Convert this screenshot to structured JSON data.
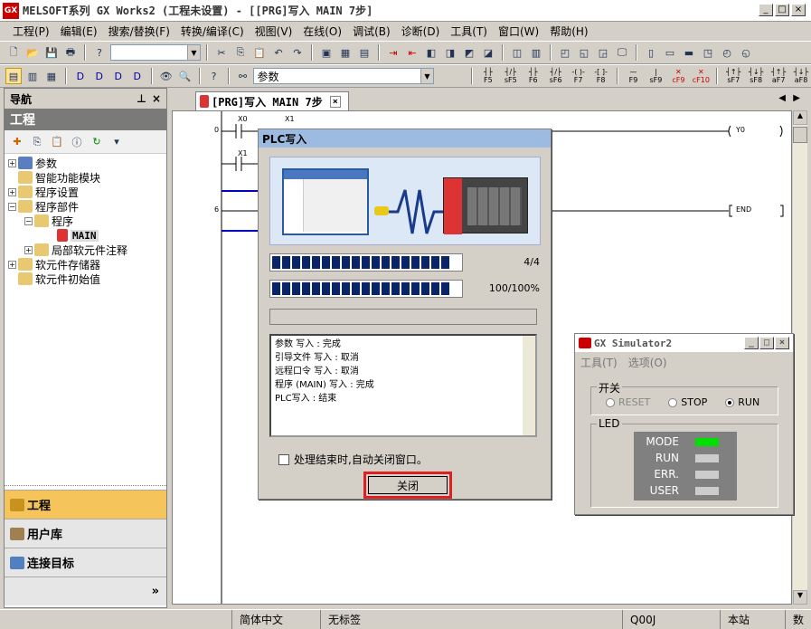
{
  "window": {
    "title": "MELSOFT系列 GX Works2 (工程未设置) - [[PRG]写入 MAIN 7步]",
    "icon_text": "GX"
  },
  "menu": [
    "工程(P)",
    "编辑(E)",
    "搜索/替换(F)",
    "转换/编译(C)",
    "视图(V)",
    "在线(O)",
    "调试(B)",
    "诊断(D)",
    "工具(T)",
    "窗口(W)",
    "帮助(H)"
  ],
  "toolbar2": {
    "combo_value": "参数"
  },
  "function_keys": [
    "F5",
    "sF5",
    "F6",
    "sF6",
    "F7",
    "F8",
    "F9",
    "sF9",
    "cF9",
    "cF10",
    "sF7",
    "sF8",
    "aF7",
    "aF8"
  ],
  "nav": {
    "header": "导航",
    "title": "工程",
    "tree": [
      {
        "label": "参数",
        "level": 0,
        "expander": "+"
      },
      {
        "label": "智能功能模块",
        "level": 0,
        "expander": ""
      },
      {
        "label": "程序设置",
        "level": 0,
        "expander": "+"
      },
      {
        "label": "程序部件",
        "level": 0,
        "expander": "−"
      },
      {
        "label": "程序",
        "level": 1,
        "expander": "−"
      },
      {
        "label": "MAIN",
        "level": 2,
        "expander": ""
      },
      {
        "label": "局部软元件注释",
        "level": 1,
        "expander": "+"
      },
      {
        "label": "软元件存储器",
        "level": 0,
        "expander": "+"
      },
      {
        "label": "软元件初始值",
        "level": 0,
        "expander": ""
      }
    ],
    "bottom": [
      "工程",
      "用户库",
      "连接目标"
    ]
  },
  "editor": {
    "tab_label": "[PRG]写入 MAIN 7步",
    "ladder": {
      "row0_step": "0",
      "row6_step": "6",
      "contact_x0": "X0",
      "contact_x1a": "X1",
      "contact_x1b": "X1",
      "coil": "Y0",
      "end": "END"
    }
  },
  "dialog": {
    "title": "PLC写入",
    "progress1_text": "4/4",
    "progress1_value": 1.0,
    "progress2_text": "100/100%",
    "progress2_value": 1.0,
    "log_lines": [
      "参数 写入 : 完成",
      "引导文件 写入 : 取消",
      "远程口令 写入 : 取消",
      "程序 (MAIN) 写入 : 完成",
      "PLC写入 : 结束"
    ],
    "auto_close_label": "处理结束时,自动关闭窗口。",
    "close_button": "关闭"
  },
  "simulator": {
    "title": "GX Simulator2",
    "menu": [
      "工具(T)",
      "选项(O)"
    ],
    "switch_group": "开关",
    "switch_options": [
      "RESET",
      "STOP",
      "RUN"
    ],
    "switch_selected": "RUN",
    "led_group": "LED",
    "leds": [
      {
        "name": "MODE",
        "color": "#00e000"
      },
      {
        "name": "RUN",
        "color": "#cccccc"
      },
      {
        "name": "ERR.",
        "color": "#cccccc"
      },
      {
        "name": "USER",
        "color": "#cccccc"
      }
    ]
  },
  "status": [
    "简体中文",
    "无标签",
    "Q00J",
    "本站",
    "数"
  ]
}
